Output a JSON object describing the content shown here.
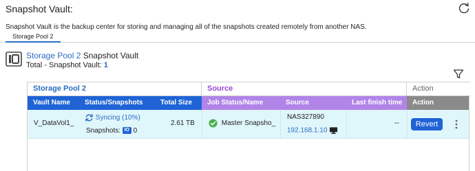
{
  "page": {
    "title": "Snapshot Vault:",
    "description": "Snapshot Vault is the backup center for storing and managing all of the snapshots created remotely from another NAS."
  },
  "tabs": [
    {
      "label": "Storage Pool  2",
      "active": true
    }
  ],
  "pool": {
    "name": "Storage Pool 2",
    "suffix": " Snapshot Vault",
    "total_label": "Total - Snapshot Vault: ",
    "total_count": "1"
  },
  "table": {
    "groups": {
      "pool": "Storage Pool 2",
      "source": "Source",
      "action": "Action"
    },
    "columns": {
      "vault_name": "Vault Name",
      "status": "Status/Snapshots",
      "total_size": "Total Size",
      "job_status": "Job Status/Name",
      "source": "Source",
      "last_finish": "Last finish time",
      "action": "Action"
    },
    "rows": [
      {
        "vault_name": "V_DataVol1_",
        "sync_status": "Syncing (10%)",
        "snapshots_label": "Snapshots: ",
        "snapshots_badge": "IO",
        "snapshots_count": "0",
        "total_size": "2.61 TB",
        "job_name": "Master Snapsho_",
        "source_name": "NAS327890",
        "source_ip": "192.168.1.10",
        "last_finish": "--",
        "action_label": "Revert"
      }
    ]
  },
  "colors": {
    "accent": "#1f63d6",
    "link": "#2b6cc4",
    "source_header": "#b184e8",
    "action_header": "#8a8a8a",
    "row_highlight": "#dff6fb",
    "ok": "#4caf50"
  },
  "icons": {
    "refresh": "refresh-icon",
    "pool": "storage-pool-icon",
    "filter": "filter-icon",
    "sync": "sync-icon",
    "ok": "check-circle-icon",
    "monitor": "monitor-icon",
    "more": "more-vertical-icon"
  }
}
